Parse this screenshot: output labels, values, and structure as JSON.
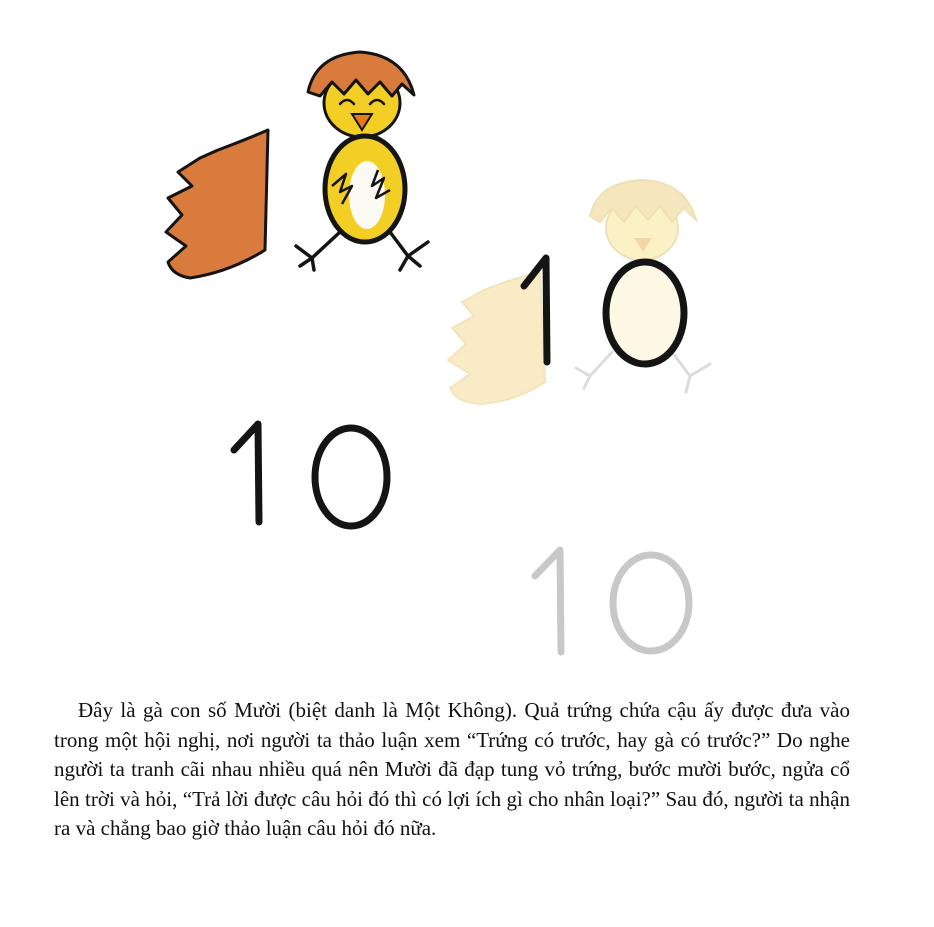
{
  "illustration": {
    "numeral_big": "10",
    "numeral_faded": "10",
    "numeral_stacked": "10",
    "colors": {
      "shell": "#d97b3c",
      "chick": "#f3cf26",
      "outline": "#141414",
      "faded_shell": "#f9ebc6",
      "faded_number": "#c8c8c8"
    }
  },
  "caption": {
    "text": "Đây là gà con số Mười (biệt danh là Một Không). Quả trứng chứa cậu ấy được đưa vào trong một hội nghị, nơi người ta thảo luận xem “Trứng có trước, hay gà có trước?” Do nghe người ta tranh cãi nhau nhiều quá nên Mười đã đạp tung vỏ trứng, bước mười bước, ngửa cổ lên trời và hỏi, “Trả lời được câu hỏi đó thì có lợi ích gì cho nhân loại?” Sau đó, người ta nhận ra và chẳng bao giờ thảo luận câu hỏi đó nữa."
  }
}
